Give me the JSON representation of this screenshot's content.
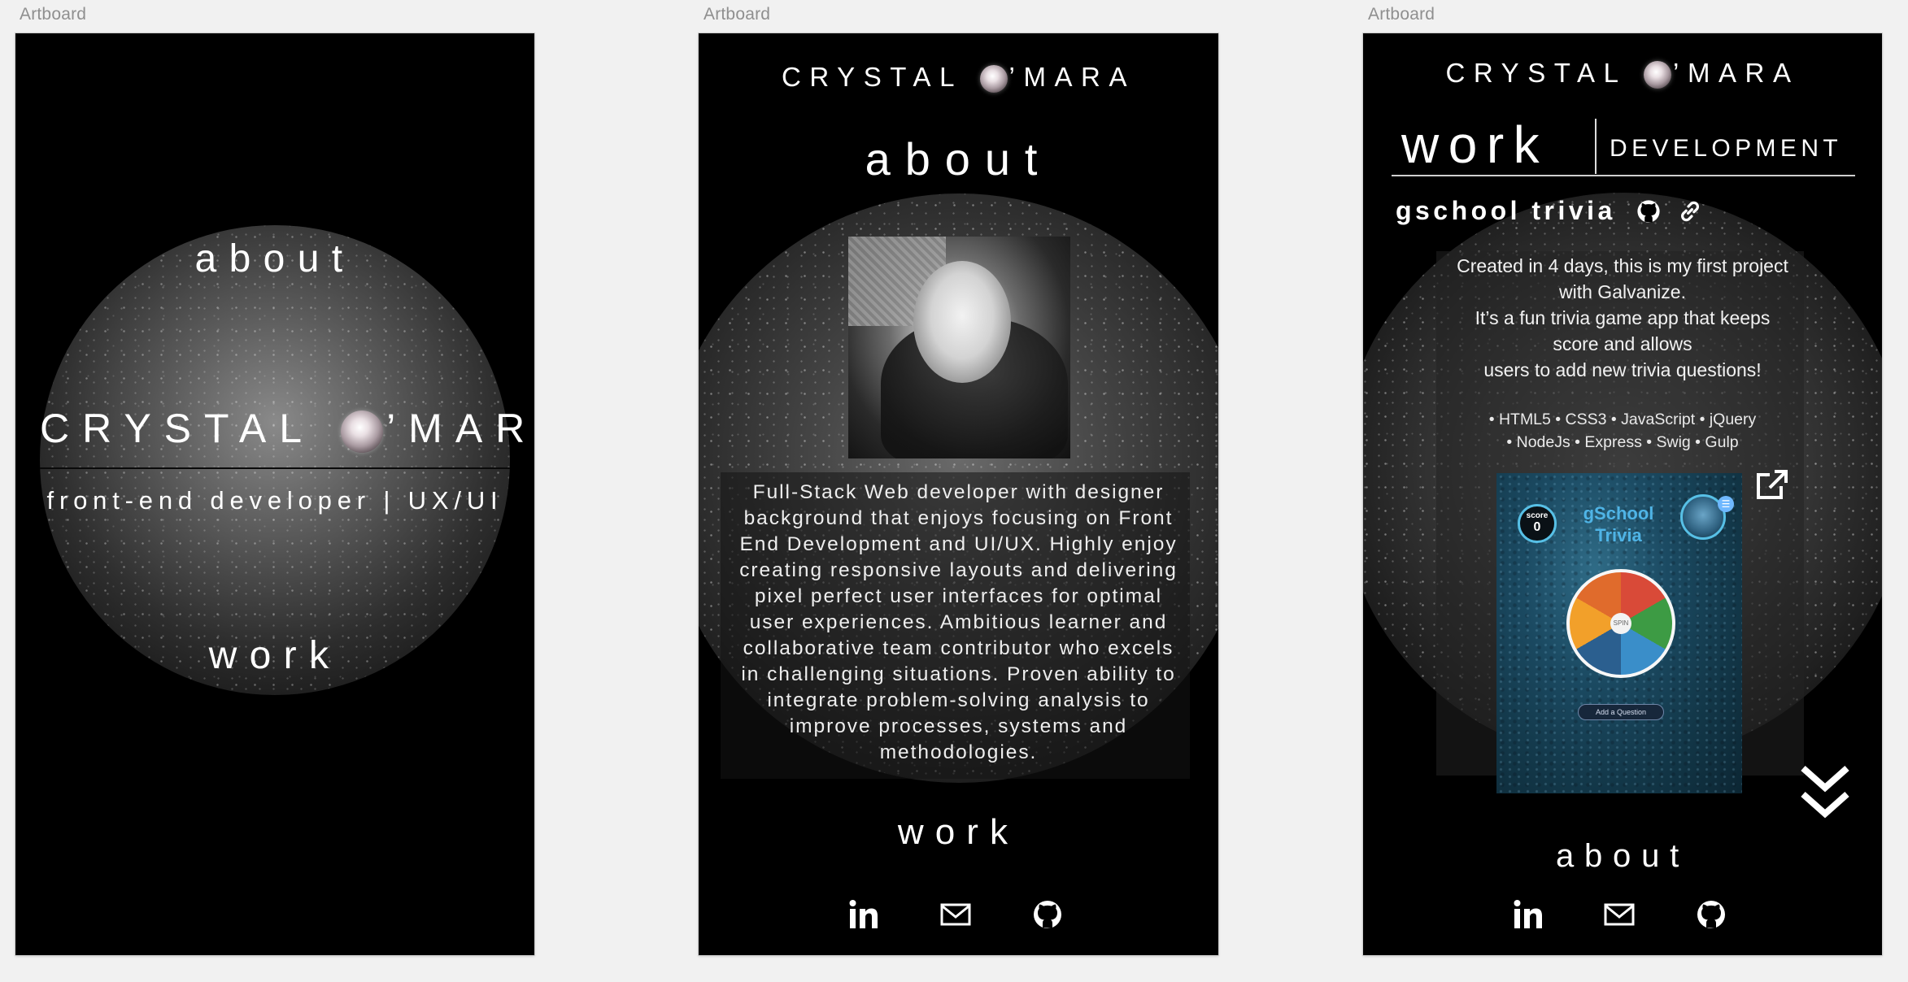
{
  "artboard_label": "Artboard",
  "brand": {
    "name_left": "CRYSTAL",
    "name_right": "’MARA"
  },
  "home": {
    "nav_about": "about",
    "subtitle": "front-end developer | UX/UI",
    "nav_work": "work"
  },
  "about_page": {
    "title": "about",
    "bio": "Full-Stack Web developer with designer background that enjoys focusing on Front End Development and UI/UX. Highly enjoy creating responsive layouts and delivering pixel perfect user interfaces for optimal user experiences. Ambitious learner and collaborative team contributor who excels in challenging situations. Proven ability to integrate problem-solving analysis to improve processes, systems and methodologies.",
    "nav_work": "work"
  },
  "work_page": {
    "title": "work",
    "subtitle": "DEVELOPMENT",
    "project": {
      "name": "gschool trivia",
      "desc_line1": "Created in 4 days, this is my first project",
      "desc_line2": "with Galvanize.",
      "desc_line3": "It’s a fun trivia game app that keeps",
      "desc_line4": "score and allows",
      "desc_line5": "users to add new trivia questions!",
      "tech_line1": "• HTML5 • CSS3 •  JavaScript • jQuery",
      "tech_line2": "• NodeJs • Express • Swig • Gulp",
      "screenshot": {
        "score_label": "score",
        "score_value": "0",
        "title_line1": "gSchool",
        "title_line2": "Trivia",
        "spin_label": "SPIN",
        "add_button": "Add a Question"
      }
    },
    "nav_about": "about"
  },
  "icons": {
    "linkedin": "linkedin-icon",
    "email": "mail-icon",
    "github": "github-icon",
    "link": "link-icon",
    "external": "external-link-icon",
    "scroll": "double-chevron-down-icon"
  },
  "colors": {
    "artboard_bg": "#000000",
    "canvas_bg": "#f1f1f1",
    "game_blue": "#4fb4e6"
  }
}
